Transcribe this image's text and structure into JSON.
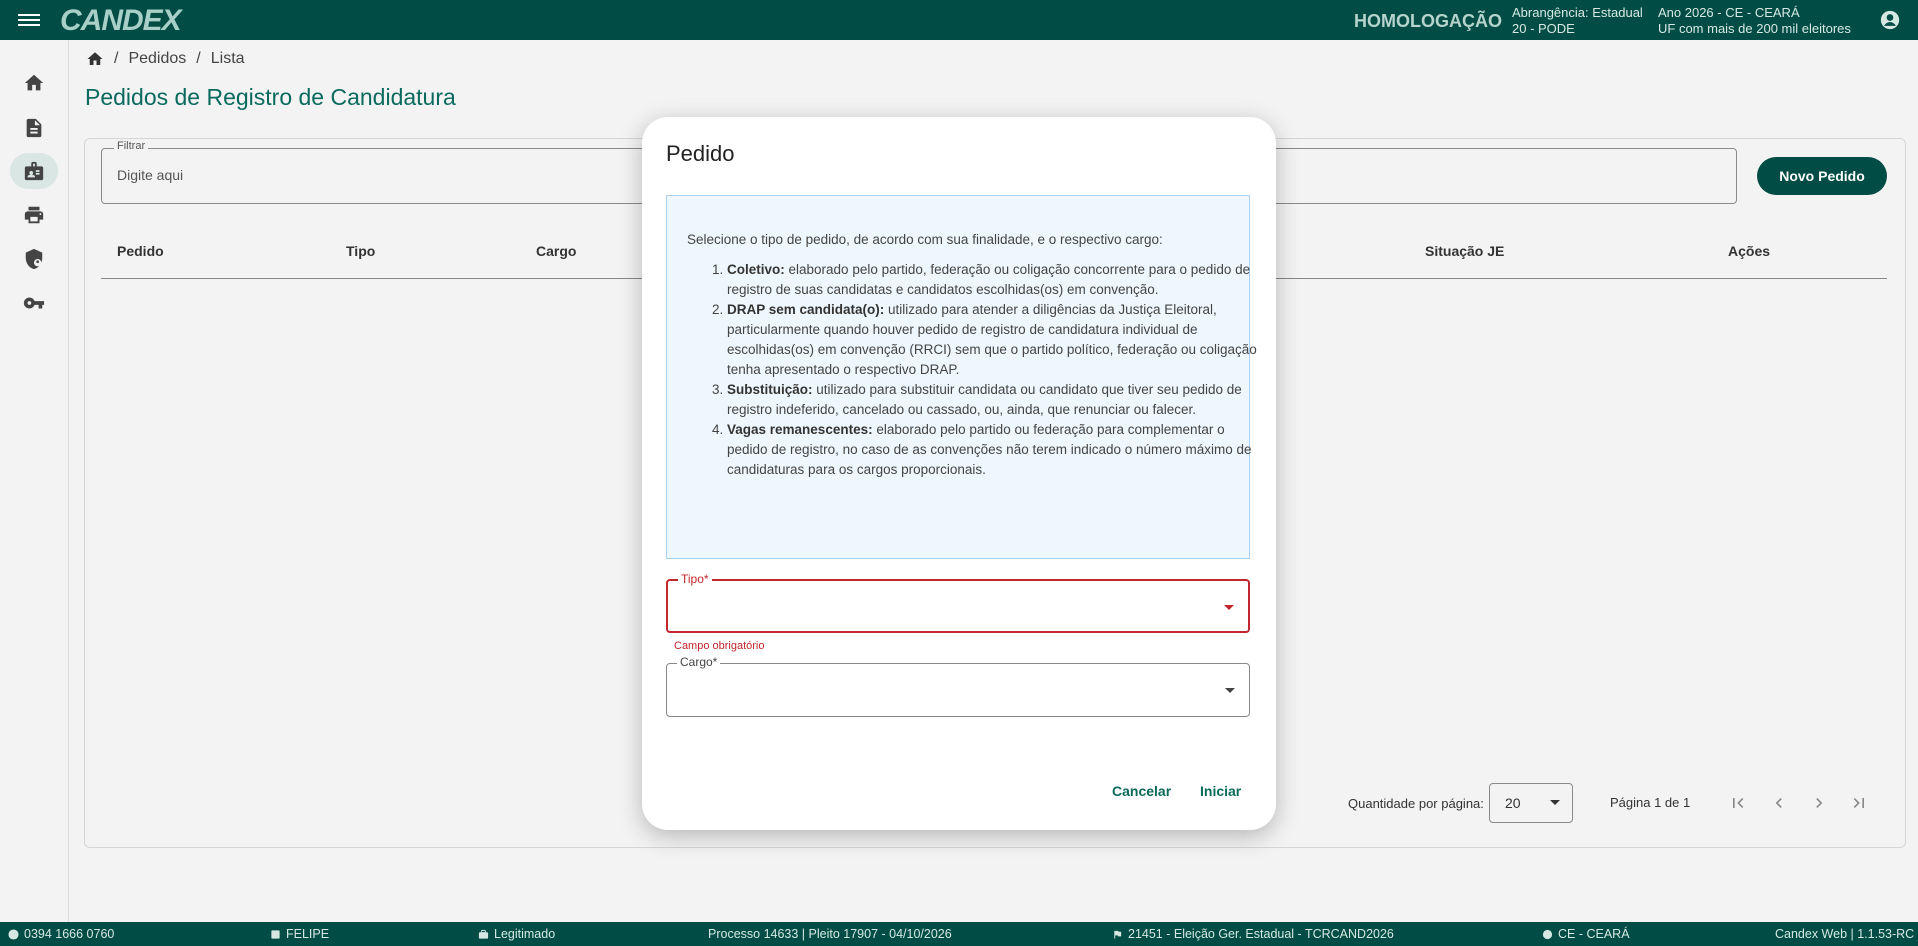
{
  "header": {
    "logo": "CANDEX",
    "environment": "HOMOLOGAÇÃO",
    "abrangencia_line1": "Abrangência: Estadual",
    "abrangencia_line2": "20 - PODE",
    "ano_line1": "Ano 2026 - CE - CEARÁ",
    "ano_line2": "UF com mais de 200 mil eleitores"
  },
  "sidebar": {
    "items": [
      {
        "icon": "home-icon"
      },
      {
        "icon": "document-icon"
      },
      {
        "icon": "badge-icon",
        "active": true
      },
      {
        "icon": "print-icon"
      },
      {
        "icon": "shield-user-icon"
      },
      {
        "icon": "key-icon"
      }
    ]
  },
  "breadcrumb": {
    "items": [
      "Pedidos",
      "Lista"
    ],
    "separator": "/"
  },
  "page": {
    "title": "Pedidos de Registro de Candidatura"
  },
  "filter": {
    "label": "Filtrar",
    "placeholder": "Digite aqui"
  },
  "actions": {
    "new_label": "Novo Pedido"
  },
  "table": {
    "columns": [
      "Pedido",
      "Tipo",
      "Cargo",
      "Situação JE",
      "Ações"
    ]
  },
  "pagination": {
    "per_page_label": "Quantidade por página:",
    "per_page_value": "20",
    "page_info": "Página 1 de 1"
  },
  "dialog": {
    "title": "Pedido",
    "intro": "Selecione o tipo de pedido, de acordo com sua finalidade, e o respectivo cargo:",
    "items": [
      {
        "term": "Coletivo:",
        "text": " elaborado pelo partido, federação ou coligação concorrente para o pedido de registro de suas candidatas e candidatos escolhidas(os) em convenção."
      },
      {
        "term": "DRAP sem candidata(o):",
        "text": " utilizado para atender a diligências da Justiça Eleitoral, particularmente quando houver pedido de registro de candidatura individual de escolhidas(os) em convenção (RRCI) sem que o partido político, federação ou coligação tenha apresentado o respectivo DRAP."
      },
      {
        "term": "Substituição:",
        "text": " utilizado para substituir candidata ou candidato que tiver seu pedido de registro indeferido, cancelado ou cassado, ou, ainda, que renunciar ou falecer."
      },
      {
        "term": "Vagas remanescentes:",
        "text": " elaborado pelo partido ou federação para complementar o pedido de registro, no caso de as convenções não terem indicado o número máximo de candidaturas para os cargos proporcionais."
      }
    ],
    "tipo_label": "Tipo*",
    "tipo_error": "Campo obrigatório",
    "cargo_label": "Cargo*",
    "cancel_label": "Cancelar",
    "start_label": "Iniciar"
  },
  "statusbar": {
    "user_id": "0394 1666 0760",
    "user_name": "FELIPE",
    "role": "Legitimado",
    "process": "Processo 14633 | Pleito 17907 - 04/10/2026",
    "election": "21451 - Eleição Ger. Estadual - TCRCAND2026",
    "state": "CE - CEARÁ",
    "version": "Candex Web | 1.1.53-RC"
  },
  "colors": {
    "primary": "#014d45",
    "accent": "#0b6a5e",
    "error": "#c2272d",
    "info_bg": "#eef7fd"
  }
}
